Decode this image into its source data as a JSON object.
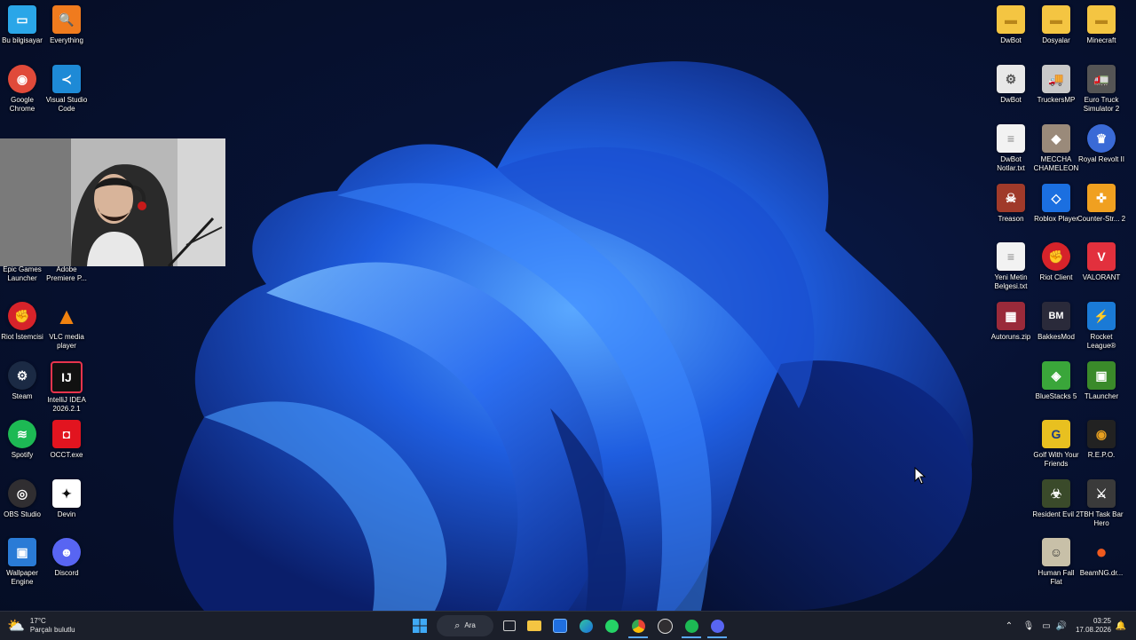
{
  "desktop": {
    "left_icons": [
      {
        "label": "Bu bilgisayar",
        "icon": "pc-icon",
        "color": "#2aa6e8",
        "glyph": "▭"
      },
      {
        "label": "Everything",
        "icon": "magnifier-icon",
        "color": "#f07b1e",
        "glyph": "🔍"
      },
      {
        "label": "Google Chrome",
        "icon": "chrome-icon",
        "color": "#e04a3a",
        "glyph": "◉"
      },
      {
        "label": "Visual Studio Code",
        "icon": "vscode-icon",
        "color": "#1e8ad6",
        "glyph": "≺"
      },
      {
        "label": "Epic Games Launcher",
        "icon": "epic-icon",
        "color": "#2a2a2a",
        "glyph": "E"
      },
      {
        "label": "Adobe Premiere P...",
        "icon": "premiere-icon",
        "color": "#1a0b3a",
        "glyph": "Pr"
      },
      {
        "label": "Riot İstemcisi",
        "icon": "riot-icon",
        "color": "#d6232a",
        "glyph": "✊"
      },
      {
        "label": "VLC media player",
        "icon": "vlc-icon",
        "color": "#f0820f",
        "glyph": "▲"
      },
      {
        "label": "Steam",
        "icon": "steam-icon",
        "color": "#1b2a44",
        "glyph": "⚙"
      },
      {
        "label": "IntelliJ IDEA 2026.2.1",
        "icon": "intellij-icon",
        "color": "#e8344d",
        "glyph": "IJ"
      },
      {
        "label": "Spotify",
        "icon": "spotify-icon",
        "color": "#1db954",
        "glyph": "≋"
      },
      {
        "label": "OCCT.exe",
        "icon": "occt-icon",
        "color": "#e2141f",
        "glyph": "◘"
      },
      {
        "label": "OBS Studio",
        "icon": "obs-icon",
        "color": "#302e31",
        "glyph": "◎"
      },
      {
        "label": "Devin",
        "icon": "devin-icon",
        "color": "#111111",
        "glyph": "✦"
      },
      {
        "label": "Wallpaper Engine",
        "icon": "wallpaper-engine-icon",
        "color": "#2a7bd6",
        "glyph": "▣"
      },
      {
        "label": "Discord",
        "icon": "discord-icon",
        "color": "#5865f2",
        "glyph": "☻"
      }
    ],
    "right_icons": [
      {
        "label": "DwBot",
        "icon": "folder-icon",
        "color": "#f4c542",
        "glyph": "▬"
      },
      {
        "label": "Dosyalar",
        "icon": "folder-icon",
        "color": "#f4c542",
        "glyph": "▬"
      },
      {
        "label": "Minecraft",
        "icon": "folder-icon",
        "color": "#f4c542",
        "glyph": "▬"
      },
      {
        "label": "DwBot",
        "icon": "settings-file-icon",
        "color": "#e8e8e8",
        "glyph": "⚙"
      },
      {
        "label": "TruckersMP",
        "icon": "truckersmp-icon",
        "color": "#c8c8c8",
        "glyph": "🚚"
      },
      {
        "label": "Euro Truck Simulator 2",
        "icon": "ets2-icon",
        "color": "#555555",
        "glyph": "🚛"
      },
      {
        "label": "DwBot Notlar.txt",
        "icon": "text-file-icon",
        "color": "#f2f2f2",
        "glyph": "≡"
      },
      {
        "label": "MECCHA CHAMELEON",
        "icon": "meccha-icon",
        "color": "#9a8a7a",
        "glyph": "◆"
      },
      {
        "label": "Royal Revolt II",
        "icon": "royal-revolt-icon",
        "color": "#3a6ad6",
        "glyph": "♛"
      },
      {
        "label": "Treason",
        "icon": "treason-icon",
        "color": "#a03a2a",
        "glyph": "☠"
      },
      {
        "label": "Roblox Player",
        "icon": "roblox-icon",
        "color": "#1b6fe0",
        "glyph": "◇"
      },
      {
        "label": "Counter-Str... 2",
        "icon": "cs2-icon",
        "color": "#f0a020",
        "glyph": "✜"
      },
      {
        "label": "Yeni Metin Belgesi.txt",
        "icon": "text-file-icon",
        "color": "#f2f2f2",
        "glyph": "≡"
      },
      {
        "label": "Riot Client",
        "icon": "riot-icon",
        "color": "#d6232a",
        "glyph": "✊"
      },
      {
        "label": "VALORANT",
        "icon": "valorant-icon",
        "color": "#e2303d",
        "glyph": "V"
      },
      {
        "label": "Autoruns.zip",
        "icon": "zip-icon",
        "color": "#9a2a3a",
        "glyph": "▦"
      },
      {
        "label": "BakkesMod",
        "icon": "bakkesmod-icon",
        "color": "#2a2a3a",
        "glyph": "BM"
      },
      {
        "label": "Rocket League®",
        "icon": "rocket-league-icon",
        "color": "#1a7ad6",
        "glyph": "⚡"
      },
      {
        "label": "BlueStacks 5",
        "icon": "bluestacks-icon",
        "color": "#3aa63a",
        "glyph": "◈"
      },
      {
        "label": "TLauncher",
        "icon": "tlauncher-icon",
        "color": "#3a8a2a",
        "glyph": "▣"
      },
      {
        "label": "Golf With Your Friends",
        "icon": "golf-icon",
        "color": "#e8c020",
        "glyph": "G"
      },
      {
        "label": "R.E.P.O.",
        "icon": "repo-icon",
        "color": "#e8a020",
        "glyph": "◉"
      },
      {
        "label": "Resident Evil 2",
        "icon": "resident-evil-icon",
        "color": "#3a4a2a",
        "glyph": "☣"
      },
      {
        "label": "TBH Task Bar Hero",
        "icon": "tbh-icon",
        "color": "#3a3a3a",
        "glyph": "⚔"
      },
      {
        "label": "Human Fall Flat",
        "icon": "human-fall-flat-icon",
        "color": "#c8c0a8",
        "glyph": "☺"
      },
      {
        "label": "BeamNG.dr...",
        "icon": "beamng-icon",
        "color": "#f05a1e",
        "glyph": "●"
      }
    ]
  },
  "taskbar": {
    "weather_temp": "17°C",
    "weather_desc": "Parçalı bulutlu",
    "search_label": "Ara",
    "time": "03:25",
    "date": "17.08.2026"
  }
}
